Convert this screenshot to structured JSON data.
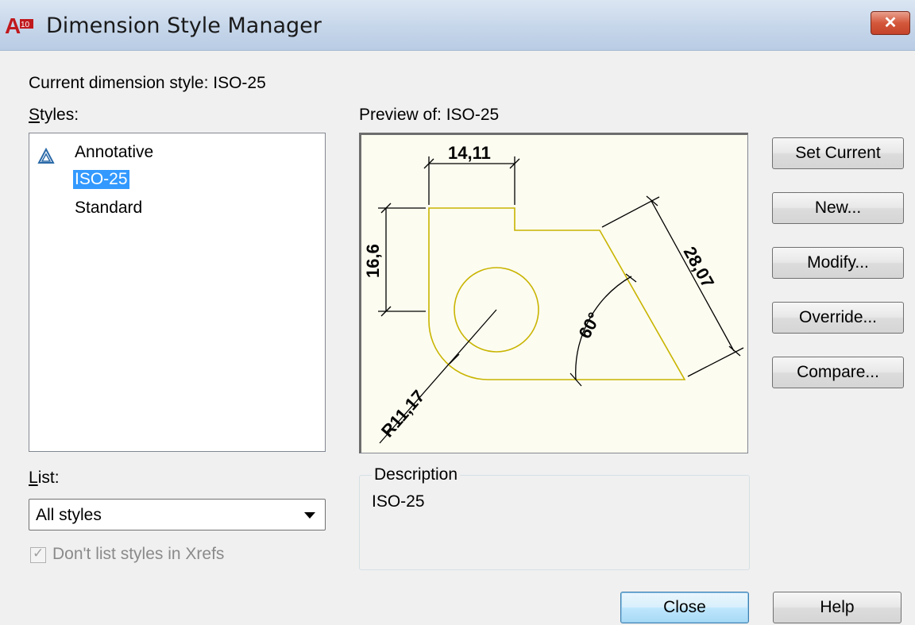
{
  "window": {
    "title": "Dimension Style Manager",
    "app_icon": "autocad-a10-icon",
    "app_icon_text": "10",
    "close_glyph": "✕"
  },
  "current_style": {
    "label": "Current dimension style: ISO-25"
  },
  "styles": {
    "label": "Styles:",
    "items": [
      {
        "label": "Annotative",
        "icon": "annotative-icon",
        "selected": false
      },
      {
        "label": "ISO-25",
        "selected": true
      },
      {
        "label": "Standard",
        "selected": false
      }
    ]
  },
  "preview": {
    "label": "Preview of: ISO-25",
    "dimensions": {
      "top": "14,11",
      "left": "16,6",
      "diagonal": "28,07",
      "angle": "60°",
      "radius": "R11,17"
    }
  },
  "buttons": {
    "set_current": "Set Current",
    "new": "New...",
    "modify": "Modify...",
    "override": "Override...",
    "compare": "Compare...",
    "close": "Close",
    "help": "Help"
  },
  "list": {
    "label": "List:",
    "value": "All styles"
  },
  "xref_checkbox": {
    "label": "Don't list styles in Xrefs",
    "checked": true,
    "enabled": false
  },
  "description": {
    "legend": "Description",
    "text": "ISO-25"
  },
  "colors": {
    "selection": "#3399ff",
    "preview_geometry": "#c8b400",
    "preview_background": "#fdfcf0"
  }
}
